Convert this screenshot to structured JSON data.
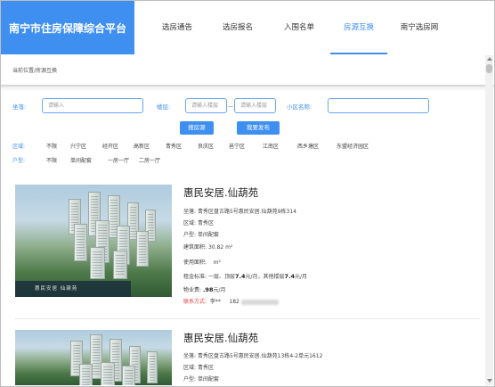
{
  "header": {
    "logo": "南宁市住房保障综合平台",
    "nav": [
      {
        "label": "选房通告",
        "active": false
      },
      {
        "label": "选房报名",
        "active": false
      },
      {
        "label": "入围名单",
        "active": false
      },
      {
        "label": "房源互换",
        "active": true
      },
      {
        "label": "南宁选房网",
        "active": false
      }
    ]
  },
  "breadcrumb": "当前位置/房源互换",
  "search": {
    "location_label": "坐落:",
    "location_placeholder": "请输入",
    "floor_label": "楼层:",
    "floor_min_placeholder": "请输入楼层",
    "floor_dash": "—",
    "floor_max_placeholder": "请输入楼层",
    "community_label": "小区名称:",
    "community_placeholder": "",
    "search_button": "搜房源",
    "publish_button": "我要发布"
  },
  "filters": {
    "district": {
      "label": "区域:",
      "options": [
        "不限",
        "兴宁区",
        "经开区",
        "高新区",
        "青秀区",
        "良庆区",
        "邕宁区",
        "江南区",
        "西乡塘区",
        "东盟经济园区"
      ]
    },
    "layout": {
      "label": "户型:",
      "options": [
        "不限",
        "单间配套",
        "一房一厅",
        "二房一厅"
      ]
    }
  },
  "listings": [
    {
      "title": "惠民安居.仙葫苑",
      "image_caption": "惠民安居 仙葫苑",
      "address_label": "坐落:",
      "address": "青秀区盘古路5号惠民安居.仙葫苑9栋314",
      "district_label": "区域:",
      "district": "青秀区",
      "layout_label": "户型:",
      "layout": "单间配套",
      "area_label": "建筑面积:",
      "area": "30.82",
      "area_unit": "m²",
      "usable_label": "使用面积:",
      "usable_unit": "m²",
      "rent_label": "租金标准:",
      "rent_text_1": "一层、顶层",
      "rent_value_1": "7.4",
      "rent_text_2": "元/月，其他楼层",
      "rent_value_2": "7.4",
      "rent_text_3": "元/月",
      "fee_label": "物业费:",
      "fee_value": ".98",
      "fee_unit": "元/月",
      "contact_label": "联系方式:",
      "contact_name": "李**",
      "contact_phone": "182"
    },
    {
      "title": "惠民安居.仙葫苑",
      "address_label": "坐落:",
      "address": "青秀区盘古路5号惠民安居.仙葫苑13栋4-2单元1612",
      "district_label": "区域:",
      "district": "青秀区",
      "layout_label": "户型:",
      "layout": "单间配套"
    }
  ]
}
